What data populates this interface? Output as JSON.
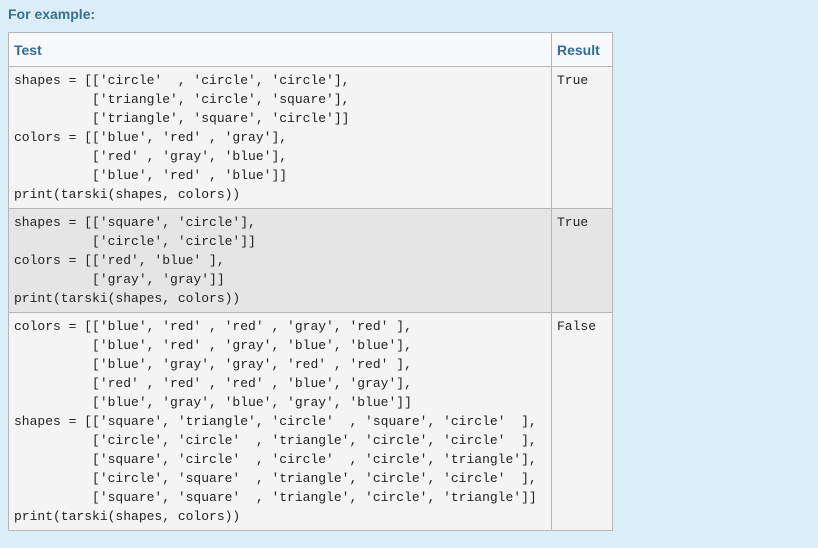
{
  "heading": "For example:",
  "table": {
    "headers": {
      "test": "Test",
      "result": "Result"
    },
    "rows": [
      {
        "test": [
          "shapes = [['circle'  , 'circle', 'circle'],",
          "          ['triangle', 'circle', 'square'],",
          "          ['triangle', 'square', 'circle']]",
          "colors = [['blue', 'red' , 'gray'],",
          "          ['red' , 'gray', 'blue'],",
          "          ['blue', 'red' , 'blue']]",
          "print(tarski(shapes, colors))"
        ],
        "result": "True"
      },
      {
        "test": [
          "shapes = [['square', 'circle'],",
          "          ['circle', 'circle']]",
          "colors = [['red', 'blue' ],",
          "          ['gray', 'gray']]",
          "print(tarski(shapes, colors))"
        ],
        "result": "True"
      },
      {
        "test": [
          "colors = [['blue', 'red' , 'red' , 'gray', 'red' ],",
          "          ['blue', 'red' , 'gray', 'blue', 'blue'],",
          "          ['blue', 'gray', 'gray', 'red' , 'red' ],",
          "          ['red' , 'red' , 'red' , 'blue', 'gray'],",
          "          ['blue', 'gray', 'blue', 'gray', 'blue']]",
          "shapes = [['square', 'triangle', 'circle'  , 'square', 'circle'  ],",
          "          ['circle', 'circle'  , 'triangle', 'circle', 'circle'  ],",
          "          ['square', 'circle'  , 'circle'  , 'circle', 'triangle'],",
          "          ['circle', 'square'  , 'triangle', 'circle', 'circle'  ],",
          "          ['square', 'square'  , 'triangle', 'circle', 'triangle']]",
          "print(tarski(shapes, colors))"
        ],
        "result": "False"
      }
    ]
  }
}
